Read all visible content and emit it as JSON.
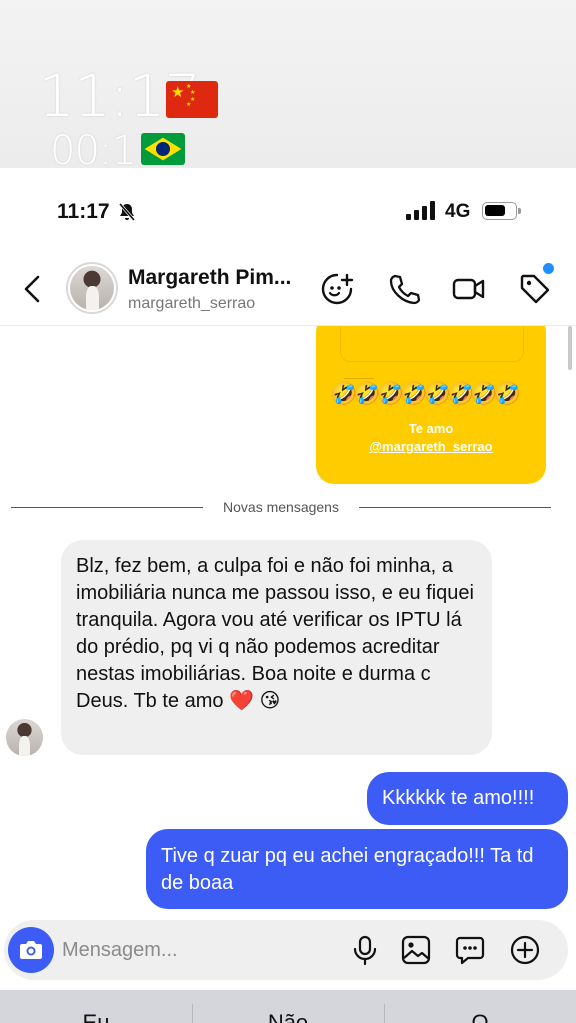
{
  "overlay": {
    "time_one": "11:17",
    "time_two": "00:17",
    "flag_one": "china-flag",
    "flag_two": "brazil-flag"
  },
  "status_bar": {
    "time": "11:17",
    "network": "4G",
    "silent_icon": "bell-slash-icon"
  },
  "header": {
    "name": "Margareth Pim...",
    "username": "margareth_serrao",
    "icons": [
      "chevron-left-icon",
      "sticker-icon",
      "phone-icon",
      "video-camera-icon",
      "tag-icon"
    ],
    "accent": "#1f8fff"
  },
  "story": {
    "emojis": "🤣🤣🤣🤣🤣🤣🤣🤣",
    "caption": "Te amo",
    "mention": "@margareth_serrao",
    "background": "#ffcc00"
  },
  "divider": {
    "label": "Novas mensagens"
  },
  "messages": {
    "incoming": {
      "text": "Blz, fez bem, a culpa foi e não foi minha, a imobiliária nunca me passou isso, e eu fiquei tranquila. Agora vou até verificar os IPTU lá do prédio, pq vi q não podemos acreditar nestas imobiliárias. Boa noite e durma c Deus. Tb te amo",
      "heart": "❤️",
      "kiss": "😘"
    },
    "outgoing": [
      {
        "text": "Kkkkkk te amo!!!!"
      },
      {
        "text": "Tive q zuar pq eu achei engraçado!!! Ta td de boaa"
      }
    ],
    "outgoing_color": "#3c5cf5"
  },
  "composer": {
    "placeholder": "Mensagem...",
    "icons": [
      "camera-icon",
      "microphone-icon",
      "gallery-icon",
      "chat-bubble-icon",
      "plus-circle-icon"
    ]
  },
  "keyboard_suggestions": [
    "Eu",
    "Não",
    "O"
  ]
}
